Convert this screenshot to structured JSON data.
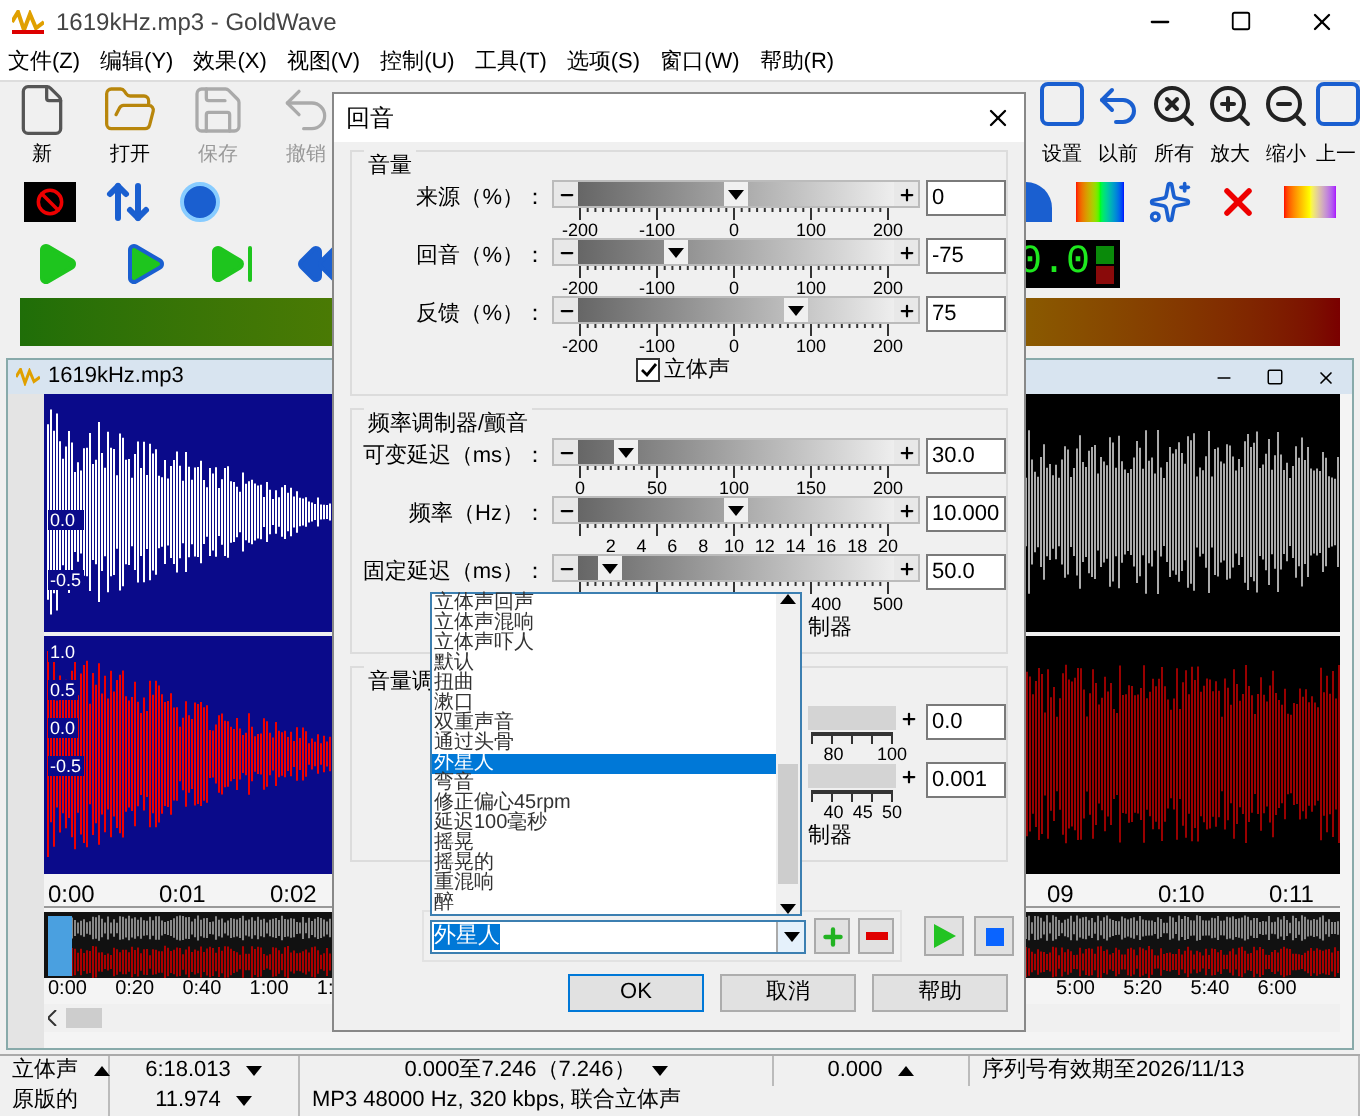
{
  "app": {
    "title": "1619kHz.mp3 - GoldWave"
  },
  "menu": [
    "文件(Z)",
    "编辑(Y)",
    "效果(X)",
    "视图(V)",
    "控制(U)",
    "工具(T)",
    "选项(S)",
    "窗口(W)",
    "帮助(R)"
  ],
  "toolbar": {
    "left_buttons": [
      {
        "label": "新",
        "disabled": false
      },
      {
        "label": "打开",
        "disabled": false
      },
      {
        "label": "保存",
        "disabled": true
      },
      {
        "label": "撤销",
        "disabled": true
      }
    ],
    "right_buttons": [
      "设置",
      "以前",
      "所有",
      "放大",
      "缩小",
      "上一"
    ]
  },
  "display": {
    "reading": "0.0"
  },
  "document": {
    "title": "1619kHz.mp3",
    "top_labels": [
      "0.0",
      "-0.5"
    ],
    "bottom_labels": [
      "1.0",
      "0.5",
      "0.0",
      "-0.5"
    ],
    "time_ruler": [
      "0:00",
      "0:01",
      "0:02",
      "09",
      "0:10",
      "0:11"
    ],
    "overview_ruler": [
      "0:00",
      "0:20",
      "0:40",
      "1:00",
      "1:",
      "5:00",
      "5:20",
      "5:40",
      "6:00"
    ]
  },
  "dialog": {
    "title": "回音",
    "groups": [
      {
        "title": "音量",
        "sliders": [
          {
            "label": "来源（%）：",
            "ticks": [
              "-200",
              "-100",
              "0",
              "100",
              "200"
            ],
            "level": 0.5,
            "value": "0"
          },
          {
            "label": "回音（%）：",
            "ticks": [
              "-200",
              "-100",
              "0",
              "100",
              "200"
            ],
            "level": 0.3125,
            "value": "-75"
          },
          {
            "label": "反馈（%）：",
            "ticks": [
              "-200",
              "-100",
              "0",
              "100",
              "200"
            ],
            "level": 0.6875,
            "value": "75"
          }
        ],
        "stereo": {
          "label": "立体声",
          "checked": true
        }
      },
      {
        "title": "频率调制器/颤音",
        "sliders": [
          {
            "label": "可变延迟（ms）：",
            "ticks": [
              "0",
              "50",
              "100",
              "150",
              "200"
            ],
            "level": 0.15,
            "value": "30.0"
          },
          {
            "label": "频率（Hz）：",
            "ticks": [
              "2",
              "4",
              "6",
              "8",
              "10",
              "12",
              "14",
              "16",
              "18",
              "20"
            ],
            "level": 0.5,
            "value": "10.000"
          },
          {
            "label": "固定延迟（ms）：",
            "ticks": [
              "400",
              "500"
            ],
            "level": 0.1,
            "value": "50.0"
          }
        ],
        "trailing": "制器"
      },
      {
        "title": "音量调",
        "sliders": [
          {
            "ticks": [
              "80",
              "100"
            ],
            "value": "0.0"
          },
          {
            "ticks": [
              "40",
              "45",
              "50"
            ],
            "value": "0.001"
          }
        ],
        "trailing": "制器"
      }
    ],
    "preset": {
      "value": "外星人",
      "options": [
        {
          "label": "立体声回声",
          "selected": false
        },
        {
          "label": "立体声混响",
          "selected": false
        },
        {
          "label": "立体声吓人",
          "selected": false
        },
        {
          "label": "默认",
          "selected": false
        },
        {
          "label": "扭曲",
          "selected": false
        },
        {
          "label": "漱口",
          "selected": false
        },
        {
          "label": "双重声音",
          "selected": false
        },
        {
          "label": "通过头骨",
          "selected": false
        },
        {
          "label": "外星人",
          "selected": true
        },
        {
          "label": "弯音",
          "selected": false
        },
        {
          "label": "修正偏心45rpm",
          "selected": false
        },
        {
          "label": "延迟100毫秒",
          "selected": false
        },
        {
          "label": "摇晃",
          "selected": false
        },
        {
          "label": "摇晃的",
          "selected": false
        },
        {
          "label": "重混响",
          "selected": false
        },
        {
          "label": "醉",
          "selected": false
        }
      ]
    },
    "buttons": [
      "OK",
      "取消",
      "帮助"
    ]
  },
  "status_bar": {
    "rows": [
      [
        {
          "text": "立体声",
          "kind": "up"
        },
        {
          "text": "6:18.013",
          "kind": "down"
        },
        {
          "text": "0.000至7.246（7.246）",
          "kind": "down"
        },
        {
          "text": "0.000",
          "kind": "up"
        },
        {
          "text": "序列号有效期至2026/11/13",
          "kind": "plain"
        }
      ],
      [
        {
          "text": "原版的",
          "kind": "plain"
        },
        {
          "text": "11.974",
          "kind": "down"
        },
        {
          "text": "MP3 48000 Hz, 320 kbps, 联合立体声",
          "kind": "plain"
        }
      ]
    ]
  }
}
